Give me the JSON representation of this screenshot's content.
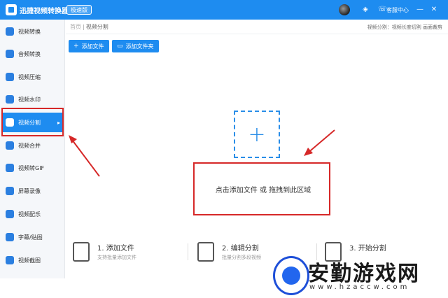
{
  "window": {
    "title": "迅捷视频转换器",
    "edition": "极速版",
    "service": "客服中心",
    "controls": [
      "—",
      "✕"
    ]
  },
  "sidebar": {
    "items": [
      {
        "label": "视频转换",
        "icon": "video-convert-icon"
      },
      {
        "label": "音频转换",
        "icon": "audio-convert-icon"
      },
      {
        "label": "视频压缩",
        "icon": "compress-icon"
      },
      {
        "label": "视频水印",
        "icon": "watermark-icon"
      },
      {
        "label": "视频分割",
        "icon": "split-icon",
        "active": true
      },
      {
        "label": "视频合并",
        "icon": "merge-icon"
      },
      {
        "label": "视频转GIF",
        "icon": "gif-icon"
      },
      {
        "label": "屏幕录像",
        "icon": "screen-record-icon"
      },
      {
        "label": "视频配乐",
        "icon": "music-icon"
      },
      {
        "label": "字幕/贴图",
        "icon": "subtitle-icon"
      },
      {
        "label": "视频截图",
        "icon": "screenshot-icon"
      }
    ]
  },
  "breadcrumb": {
    "home": "首页",
    "current": "视频分割"
  },
  "hint": "视频分割：视频长度切割 画面裁剪",
  "toolbar": {
    "add_file": "添加文件",
    "add_folder": "添加文件夹"
  },
  "dropzone": {
    "text": "点击添加文件 或 拖拽到此区域",
    "plus": "+"
  },
  "steps": [
    {
      "title": "1. 添加文件",
      "desc": "支持批量添加文件"
    },
    {
      "title": "2. 编辑分割",
      "desc": "批量分割多段视频"
    },
    {
      "title": "3. 开始分割",
      "desc": ""
    }
  ],
  "watermark": {
    "title": "安勤游戏网",
    "url": "www.hzaccw.com"
  },
  "colors": {
    "accent": "#1e8cf0",
    "highlight": "#d62828"
  }
}
